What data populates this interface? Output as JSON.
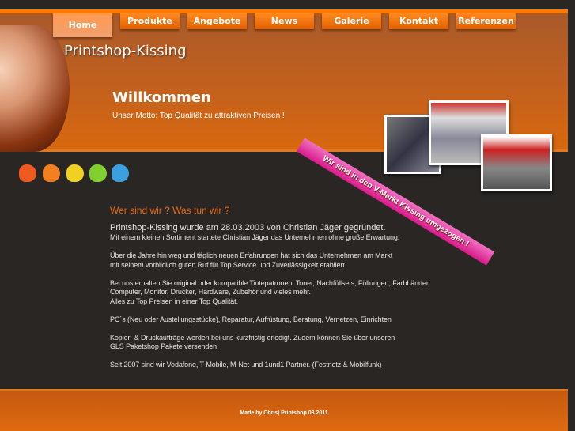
{
  "nav": [
    "Home",
    "Produkte",
    "Angebote",
    "News",
    "Galerie",
    "Kontakt",
    "Referenzen"
  ],
  "site_title": "Printshop-Kissing",
  "welcome": "Willkommen",
  "motto": "Unser Motto: Top Qualität zu attraktiven Preisen !",
  "ribbon": "Wir sind in den V-Markt Kissing umgezogen !",
  "colors": {
    "accent": "#e86a10",
    "ribbon": "#e0309a",
    "blobs": [
      "#f05a20",
      "#f08020",
      "#f0d020",
      "#80d030",
      "#3aa0e0"
    ]
  },
  "section_title": "Wer sind wir ?  Was tun wir ?",
  "lead": "Printshop-Kissing wurde am 28.03.2003 von Christian Jäger gegründet.",
  "paragraphs": [
    [
      "Mit einem kleinen Sortiment startete Christian Jäger das Unternehmen ohne große Erwartung."
    ],
    [
      "Über die Jahre hin weg und täglich neuen Erfahrungen hat sich das Unternehmen am Markt",
      "mit seinem vorbildlich guten Ruf für Top Service und Zuverlässigkeit etabliert."
    ],
    [
      "Bei uns erhalten Sie original oder kompatible Tintepatronen, Toner, Nachfüllsets, Füllungen, Farbbänder",
      "Computer, Monitor, Drucker, Hardware, Zubehör und vieles mehr.",
      "Alles zu Top Preisen in einer Top Qualität."
    ],
    [
      "PC´s (Neu oder Austellungsstücke), Reparatur, Aufrüstung, Beratung, Vernetzen, Einrichten"
    ],
    [
      "Kopier- & Druckaufträge  werden bei uns kurzfristig erledigt. Zudem können Sie über unseren",
      "GLS Paketshop Pakete versenden."
    ],
    [
      "Seit 2007 sind wir Vodafone, T-Mobile, M-Net und 1und1 Partner.  (Festnetz  & Mobilfunk)"
    ]
  ],
  "footer": "Made by Chris| Printshop 03.2011"
}
